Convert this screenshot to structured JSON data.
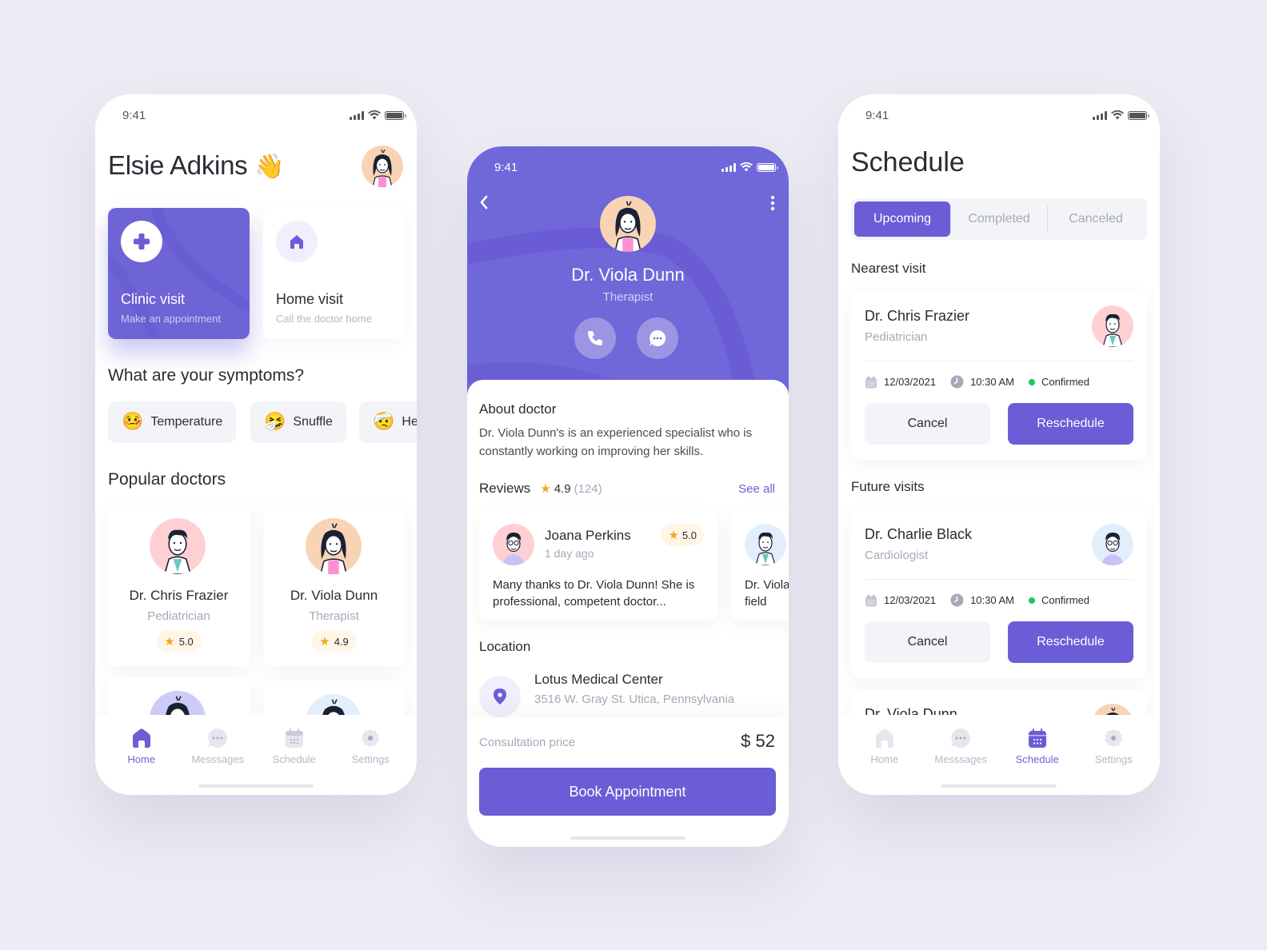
{
  "colors": {
    "background": "#ECEBF3",
    "accent": "#6A5DD6",
    "accent_light": "#7067D8",
    "muted_text": "#A6A9B8",
    "star": "#F5A623",
    "confirmed": "#22C55E"
  },
  "status_bar": {
    "time": "9:41"
  },
  "home": {
    "greeting": "Elsie Adkins",
    "greeting_emoji": "👋",
    "visit_cards": [
      {
        "title": "Clinic visit",
        "subtitle": "Make an appointment",
        "icon": "plus-icon"
      },
      {
        "title": "Home visit",
        "subtitle": "Call the doctor home",
        "icon": "house-icon"
      }
    ],
    "symptoms_title": "What are your symptoms?",
    "symptoms": [
      {
        "emoji": "🤒",
        "label": "Temperature"
      },
      {
        "emoji": "🤧",
        "label": "Snuffle"
      },
      {
        "emoji": "🤕",
        "label": "Headache"
      }
    ],
    "popular_title": "Popular doctors",
    "doctors": [
      {
        "name": "Dr. Chris Frazier",
        "specialty": "Pediatrician",
        "rating": "5.0"
      },
      {
        "name": "Dr. Viola Dunn",
        "specialty": "Therapist",
        "rating": "4.9"
      }
    ]
  },
  "tabbar": {
    "items": [
      {
        "label": "Home",
        "icon": "home-icon"
      },
      {
        "label": "Messsages",
        "icon": "chat-icon"
      },
      {
        "label": "Schedule",
        "icon": "calendar-icon"
      },
      {
        "label": "Settings",
        "icon": "gear-icon"
      }
    ]
  },
  "doctor": {
    "name": "Dr. Viola Dunn",
    "specialty": "Therapist",
    "about_title": "About doctor",
    "about_text": "Dr. Viola Dunn's is an experienced specialist who is constantly working on improving her skills.",
    "reviews_title": "Reviews",
    "rating": "4.9",
    "review_count": "(124)",
    "see_all": "See all",
    "reviews": [
      {
        "author": "Joana Perkins",
        "time": "1 day ago",
        "rating": "5.0",
        "text": "Many thanks to Dr. Viola Dunn! She is professional, competent doctor..."
      },
      {
        "text": "Dr. Viola Dunn is the best doctor in her field"
      }
    ],
    "location_title": "Location",
    "location_name": "Lotus Medical Center",
    "location_address": "3516 W. Gray St. Utica, Pennsylvania",
    "price_label": "Consultation price",
    "price": "$ 52",
    "book_button": "Book Appointment"
  },
  "schedule": {
    "title": "Schedule",
    "tabs": [
      {
        "label": "Upcoming",
        "active": true
      },
      {
        "label": "Completed",
        "active": false
      },
      {
        "label": "Canceled",
        "active": false
      }
    ],
    "nearest_title": "Nearest visit",
    "future_title": "Future visits",
    "visits": [
      {
        "name": "Dr. Chris Frazier",
        "specialty": "Pediatrician",
        "date": "12/03/2021",
        "time": "10:30 AM",
        "status": "Confirmed"
      },
      {
        "name": "Dr. Charlie Black",
        "specialty": "Cardiologist",
        "date": "12/03/2021",
        "time": "10:30 AM",
        "status": "Confirmed"
      },
      {
        "name": "Dr. Viola Dunn"
      }
    ],
    "cancel_label": "Cancel",
    "reschedule_label": "Reschedule"
  }
}
